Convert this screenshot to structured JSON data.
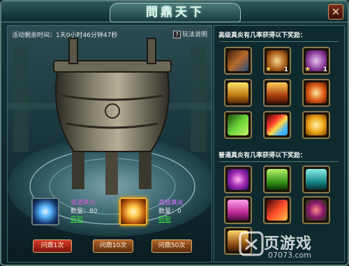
{
  "window": {
    "title": "問鼎天下",
    "close_label": "✕"
  },
  "event": {
    "timer_text": "活动剩余时间：1天0小时46分钟47秒",
    "help_label": "玩法说明"
  },
  "flames": [
    {
      "name": "普通真炎",
      "count_label": "数量：80",
      "obtain_label": "获取",
      "icon": "blue-swirl-flame-icon"
    },
    {
      "name": "高级真炎",
      "count_label": "数量：0",
      "obtain_label": "获取",
      "icon": "gold-sun-flame-icon"
    }
  ],
  "actions": [
    {
      "label": "问鼎1次"
    },
    {
      "label": "问鼎10次"
    },
    {
      "label": "问鼎50次"
    }
  ],
  "rewards": {
    "advanced_title": "高级真炎有几率获得以下奖励：",
    "normal_title": "普通真炎有几率获得以下奖励：",
    "advanced_items": [
      {
        "icon": "crossed-swords-icon",
        "stars": "",
        "qty": ""
      },
      {
        "icon": "helmet-star-icon",
        "stars": "★",
        "qty": "1"
      },
      {
        "icon": "helmet-purple-star-icon",
        "stars": "★",
        "qty": "1"
      },
      {
        "icon": "golden-chest-icon",
        "stars": "",
        "qty": ""
      },
      {
        "icon": "red-gold-chest-icon",
        "stars": "",
        "qty": ""
      },
      {
        "icon": "flame-orb-icon",
        "stars": "",
        "qty": ""
      },
      {
        "icon": "green-scroll-icon",
        "stars": "",
        "qty": ""
      },
      {
        "icon": "rainbow-feather-icon",
        "stars": "",
        "qty": ""
      },
      {
        "icon": "amber-coin-icon",
        "stars": "",
        "qty": ""
      }
    ],
    "normal_items": [
      {
        "icon": "purple-gem-egg-icon"
      },
      {
        "icon": "green-chest-icon"
      },
      {
        "icon": "teal-chest-icon"
      },
      {
        "icon": "pink-chest-icon"
      },
      {
        "icon": "red-feather-icon"
      },
      {
        "icon": "purple-fruit-icon"
      },
      {
        "icon": "wooden-gold-chest-icon"
      }
    ]
  },
  "watermark": {
    "title": "页游戏",
    "url": "07073.com"
  },
  "colors": {
    "accent_gold": "#f0b030",
    "frame_teal": "#5d7e78",
    "obtain_green": "#38e038"
  }
}
